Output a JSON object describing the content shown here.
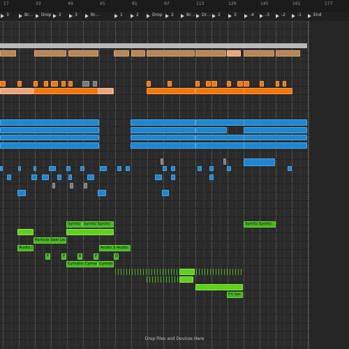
{
  "ruler": {
    "bars": [
      "17",
      "33",
      "49",
      "65",
      "81",
      "97",
      "113",
      "129",
      "145",
      "161",
      "177"
    ]
  },
  "locators": [
    {
      "label": "3"
    },
    {
      "label": "Br…"
    },
    {
      "label": "Drop"
    },
    {
      "label": "2"
    },
    {
      "label": "3"
    },
    {
      "label": "Br…"
    },
    {
      "label": "1"
    },
    {
      "label": "2"
    },
    {
      "label": "Drop"
    },
    {
      "label": "2"
    },
    {
      "label": "Br…"
    },
    {
      "label": "Dr…"
    },
    {
      "label": "2"
    },
    {
      "label": "3"
    },
    {
      "label": "-4"
    },
    {
      "label": "-3"
    },
    {
      "label": "-2"
    },
    {
      "label": "-1"
    },
    {
      "label": "End"
    }
  ],
  "clip_labels": {
    "synth_a": "Synth/ ",
    "synth_b": "Synth/ Synth/",
    "synth_c": "Synth/ Synth/",
    "particle": "Particle Saw Lea",
    "audio_a": "Audio 3",
    "audio_b": "Audio 3 Audio 3",
    "cymatics": "Cymatic Cymatic",
    "cymatics2": "Cymatic",
    "fx": "FX  Ser",
    "f": "F",
    "e": "E",
    "d": "D"
  },
  "drop_text": "Drop Files and Devices Here",
  "colors": {
    "brown": "#b88556",
    "peach": "#e8a67e",
    "orange": "#f0760e",
    "blue": "#1f86cf",
    "green": "#45b61f",
    "grey": "#7a7a7a"
  }
}
